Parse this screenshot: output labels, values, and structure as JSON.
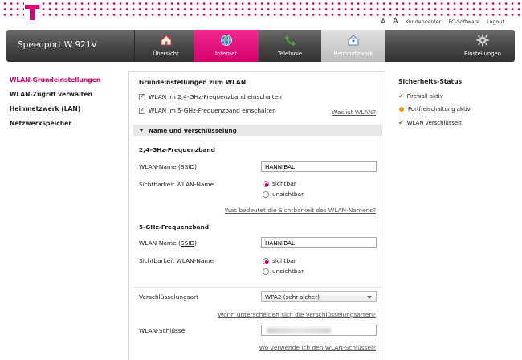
{
  "header": {
    "links": [
      "A",
      "A",
      "Kundencenter",
      "PC-Software",
      "Logout"
    ]
  },
  "nav": {
    "brand": "Speedport W 921V",
    "tabs": [
      {
        "label": "Übersicht",
        "icon": "home-icon"
      },
      {
        "label": "Internet",
        "icon": "globe-icon"
      },
      {
        "label": "Telefonie",
        "icon": "phone-icon"
      },
      {
        "label": "Heimnetzwerk",
        "icon": "network-house-icon"
      },
      {
        "label": "Einstellungen",
        "icon": "gear-icon"
      }
    ],
    "active_tab": "Heimnetzwerk",
    "accent_color": "#e20074"
  },
  "sidebar": {
    "items": [
      {
        "label": "WLAN-Grundeinstellungen",
        "active": true
      },
      {
        "label": "WLAN-Zugriff verwalten",
        "active": false
      },
      {
        "label": "Heimnetzwerk (LAN)",
        "active": false
      },
      {
        "label": "Netzwerkspeicher",
        "active": false
      }
    ]
  },
  "main": {
    "title": "Grundeinstellungen zum WLAN",
    "cb_24": "WLAN im 2,4-GHz-Frequenzband einschalten",
    "cb_5": "WLAN im 5-GHz-Frequenzband einschalten",
    "what_is_wlan": "Was ist WLAN?",
    "section": "Name und Verschlüsselung",
    "band24": {
      "heading": "2,4-GHz-Frequenzband",
      "name_label": "WLAN-Name (",
      "ssid": "SSID",
      "name_label_end": ")",
      "name_value": "HANNIBAL",
      "visibility_label": "Sichtbarkeit WLAN-Name",
      "visible": "sichtbar",
      "invisible": "unsichtbar",
      "help": "Was bedeutet die Sichtbarkeit des WLAN-Namens?"
    },
    "band5": {
      "heading": "5-GHz-Frequenzband",
      "name_label": "WLAN-Name (",
      "ssid": "SSID",
      "name_label_end": ")",
      "name_value": "HANNIBAL",
      "visibility_label": "Sichtbarkeit WLAN-Name",
      "visible": "sichtbar",
      "invisible": "unsichtbar"
    },
    "encryption_label": "Verschlüsselungsart",
    "encryption_value": "WPA2 (sehr sicher)",
    "encryption_help": "Worin unterscheiden sich die Verschlüsselungsarten?",
    "key_label": "WLAN-Schlüssel",
    "key_help": "Wo verwende ich den WLAN-Schlüssel?"
  },
  "status": {
    "title": "Sicherheits-Status",
    "items": [
      {
        "label": "Firewall aktiv",
        "state": "ok"
      },
      {
        "label": "Portfreischaltung aktiv",
        "state": "warning"
      },
      {
        "label": "WLAN verschlüsselt",
        "state": "ok"
      }
    ]
  }
}
